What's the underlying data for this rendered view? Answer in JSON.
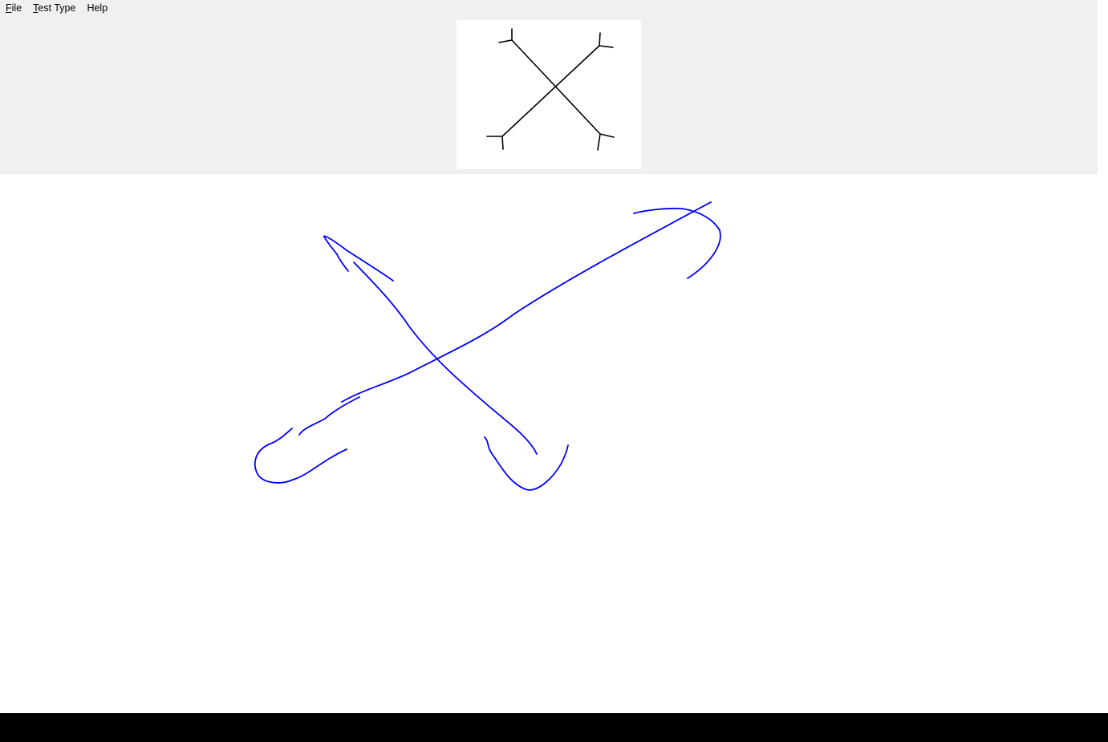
{
  "menu": {
    "items": [
      {
        "accel": "F",
        "rest": "ile"
      },
      {
        "accel": "T",
        "rest": "est Type"
      },
      {
        "accel": "",
        "rest": "Help"
      }
    ]
  },
  "reference": {
    "stroke_color": "#000000"
  },
  "drawing": {
    "ink_color": "#0000ff"
  },
  "colors": {
    "panel_bg": "#f0f0f0",
    "canvas_bg": "#ffffff",
    "taskbar_bg": "#000000"
  }
}
